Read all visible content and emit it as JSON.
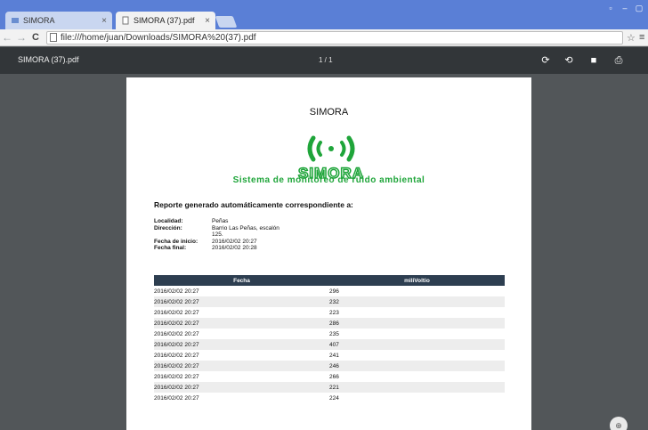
{
  "tabs": [
    {
      "title": "SIMORA",
      "close": "×"
    },
    {
      "title": "SIMORA (37).pdf",
      "close": "×"
    }
  ],
  "window_buttons": [
    "▫",
    "–",
    "▢"
  ],
  "toolbar": {
    "back": "←",
    "forward": "→",
    "reload": "C",
    "url": "file:///home/juan/Downloads/SIMORA%20(37).pdf",
    "star": "☆",
    "menu": "≡"
  },
  "pdf_viewer": {
    "filename": "SIMORA (37).pdf",
    "page_indicator": "1 / 1",
    "icons": {
      "rotate_cw": "⟳",
      "rotate_ccw": "⟲",
      "save": "■",
      "print": "⎙"
    }
  },
  "document": {
    "title": "SIMORA",
    "logo_text": "SIMORA",
    "logo_subtitle": "Sistema de monitoreo de ruido ambiental",
    "report_heading": "Reporte generado automáticamente correspondiente a:",
    "meta": {
      "localidad_label": "Localidad:",
      "localidad_value": "Peñas",
      "direccion_label": "Dirección:",
      "direccion_value": "Barrio Las Peñas, escalón",
      "direccion_value2": "125.",
      "inicio_label": "Fecha de inicio:",
      "inicio_value": "2016/02/02 20:27",
      "final_label": "Fecha final:",
      "final_value": "2016/02/02 20:28"
    },
    "table": {
      "headers": [
        "Fecha",
        "miliVoltio"
      ],
      "rows": [
        [
          "2016/02/02 20:27",
          "296"
        ],
        [
          "2016/02/02 20:27",
          "232"
        ],
        [
          "2016/02/02 20:27",
          "223"
        ],
        [
          "2016/02/02 20:27",
          "286"
        ],
        [
          "2016/02/02 20:27",
          "235"
        ],
        [
          "2016/02/02 20:27",
          "407"
        ],
        [
          "2016/02/02 20:27",
          "241"
        ],
        [
          "2016/02/02 20:27",
          "246"
        ],
        [
          "2016/02/02 20:27",
          "266"
        ],
        [
          "2016/02/02 20:27",
          "221"
        ],
        [
          "2016/02/02 20:27",
          "224"
        ]
      ]
    }
  },
  "fab": "⊕",
  "colors": {
    "accent_green": "#1fa53a",
    "table_header": "#2d3e50",
    "chrome_blue": "#5a7fd6"
  }
}
